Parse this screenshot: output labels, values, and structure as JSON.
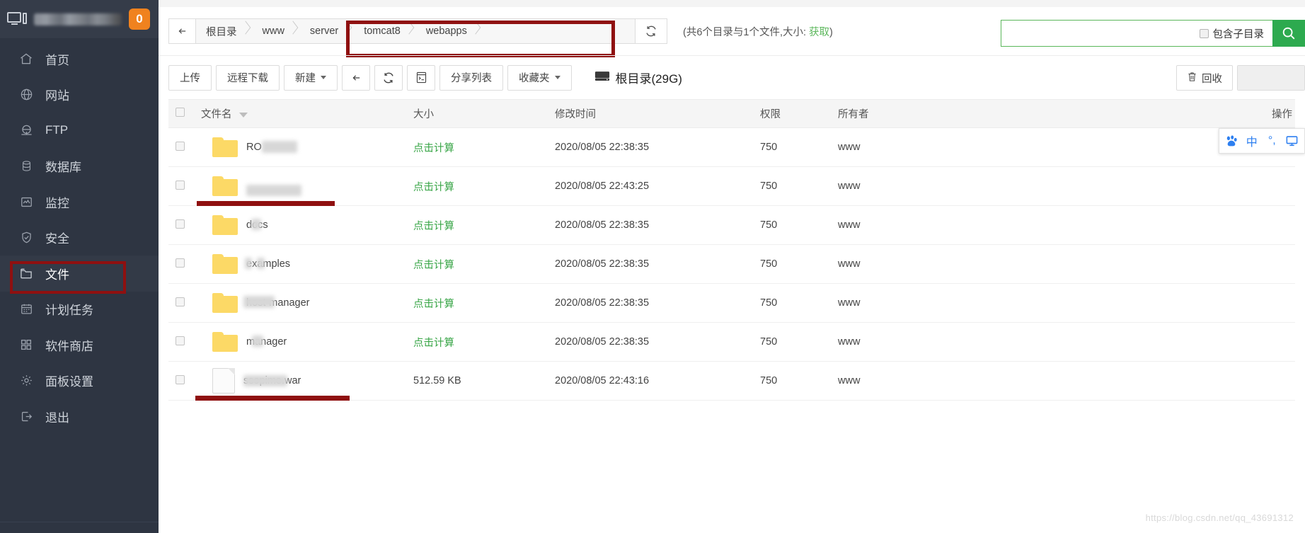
{
  "sidebar": {
    "header": {
      "badge": "0",
      "icon": "monitor-icon",
      "name_masked": ""
    },
    "items": [
      {
        "label": "首页",
        "icon": "home-icon",
        "active": false
      },
      {
        "label": "网站",
        "icon": "globe-icon",
        "active": false
      },
      {
        "label": "FTP",
        "icon": "ftp-icon",
        "active": false
      },
      {
        "label": "数据库",
        "icon": "database-icon",
        "active": false
      },
      {
        "label": "监控",
        "icon": "monitor-chart-icon",
        "active": false
      },
      {
        "label": "安全",
        "icon": "shield-icon",
        "active": false
      },
      {
        "label": "文件",
        "icon": "folder-icon",
        "active": true
      },
      {
        "label": "计划任务",
        "icon": "calendar-icon",
        "active": false
      },
      {
        "label": "软件商店",
        "icon": "apps-icon",
        "active": false
      },
      {
        "label": "面板设置",
        "icon": "gear-icon",
        "active": false
      },
      {
        "label": "退出",
        "icon": "logout-icon",
        "active": false
      }
    ]
  },
  "topbar": {
    "back_icon": "arrow-left-icon",
    "breadcrumbs": [
      "根目录",
      "www",
      "server",
      "tomcat8",
      "webapps"
    ],
    "refresh_icon": "refresh-icon",
    "dir_stat_prefix": "(共6个目录与1个文件,大小: ",
    "dir_stat_link": "获取",
    "dir_stat_suffix": ")",
    "search": {
      "value": "",
      "placeholder": "",
      "include_sub_label": "包含子目录",
      "search_icon": "search-icon"
    }
  },
  "toolbar": {
    "buttons": [
      {
        "label": "上传",
        "name": "upload-button"
      },
      {
        "label": "远程下载",
        "name": "remote-download-button"
      },
      {
        "label": "新建",
        "name": "new-button",
        "caret": true
      },
      {
        "label": "",
        "name": "back-button",
        "icon": "arrow-left-icon"
      },
      {
        "label": "",
        "name": "refresh-button",
        "icon": "refresh-icon"
      },
      {
        "label": "",
        "name": "terminal-button",
        "icon": "terminal-icon"
      },
      {
        "label": "分享列表",
        "name": "share-list-button"
      },
      {
        "label": "收藏夹",
        "name": "favorites-button",
        "caret": true
      }
    ],
    "root_size_label": "根目录(29G)",
    "root_size_icon": "disk-icon",
    "recycle_bin_label": "回收",
    "recycle_bin_icon": "trash-icon"
  },
  "ime_bar": {
    "items": [
      {
        "glyph": "🐾",
        "name": "baidu-paw-icon"
      },
      {
        "glyph": "中",
        "name": "chinese-mode-icon"
      },
      {
        "glyph": "°,",
        "name": "punctuation-mode-icon"
      },
      {
        "glyph": "⌨",
        "name": "keyboard-icon"
      }
    ]
  },
  "table": {
    "columns": [
      "文件名",
      "大小",
      "修改时间",
      "权限",
      "所有者",
      "操作"
    ],
    "sort_column": "文件名",
    "rows": [
      {
        "name": "RO",
        "masked": true,
        "type": "folder",
        "size": "点击计算",
        "size_is_link": true,
        "mtime": "2020/08/05 22:38:35",
        "perm": "750",
        "owner": "www"
      },
      {
        "name": "",
        "masked": true,
        "type": "folder",
        "size": "点击计算",
        "size_is_link": true,
        "mtime": "2020/08/05 22:43:25",
        "perm": "750",
        "owner": "www"
      },
      {
        "name": "docs",
        "masked": true,
        "type": "folder",
        "size": "点击计算",
        "size_is_link": true,
        "mtime": "2020/08/05 22:38:35",
        "perm": "750",
        "owner": "www"
      },
      {
        "name": "examples",
        "masked": true,
        "type": "folder",
        "size": "点击计算",
        "size_is_link": true,
        "mtime": "2020/08/05 22:38:35",
        "perm": "750",
        "owner": "www"
      },
      {
        "name": "host-manager",
        "masked": true,
        "type": "folder",
        "size": "点击计算",
        "size_is_link": true,
        "mtime": "2020/08/05 22:38:35",
        "perm": "750",
        "owner": "www"
      },
      {
        "name": "manager",
        "masked": true,
        "type": "folder",
        "size": "点击计算",
        "size_is_link": true,
        "mtime": "2020/08/05 22:38:35",
        "perm": "750",
        "owner": "www"
      },
      {
        "name": "ssopimo.war",
        "masked": true,
        "type": "file",
        "size": "512.59 KB",
        "size_is_link": false,
        "mtime": "2020/08/05 22:43:16",
        "perm": "750",
        "owner": "www"
      }
    ]
  },
  "watermark": "https://blog.csdn.net/qq_43691312",
  "colors": {
    "sidebar_bg": "#2e3542",
    "accent_green": "#2daa4f",
    "link_green": "#3aa648",
    "badge_orange": "#f0821e",
    "annotation_red": "#8f1010",
    "folder_yellow": "#fcd966"
  }
}
